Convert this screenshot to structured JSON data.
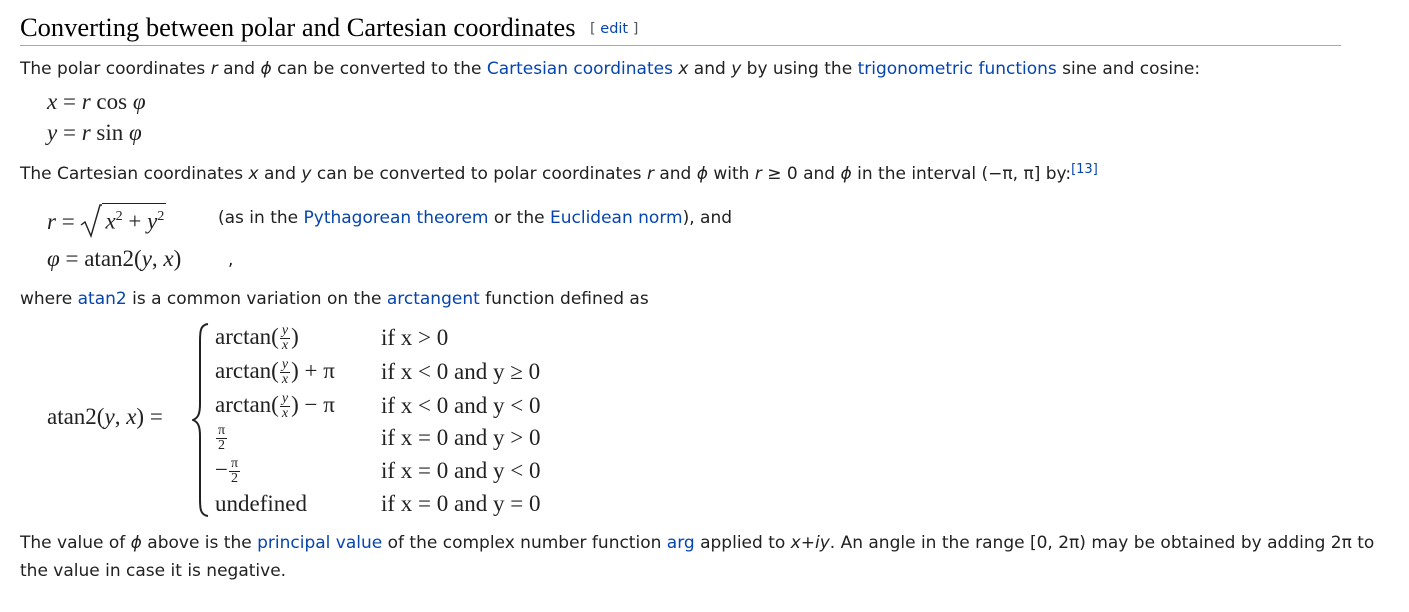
{
  "section": {
    "title": "Converting between polar and Cartesian coordinates",
    "edit_bracket_open": "[",
    "edit_label": "edit",
    "edit_bracket_close": "]"
  },
  "p1": {
    "t1": "The polar coordinates ",
    "r": "r",
    "t2": " and ",
    "phi": "ϕ",
    "t3": " can be converted to the ",
    "link_cartesian": "Cartesian coordinates",
    "t4": " ",
    "x": "x",
    "t5": " and ",
    "y": "y",
    "t6": " by using the ",
    "link_trig": "trigonometric functions",
    "t7": " sine and cosine:"
  },
  "eq_cartesian": {
    "x_lhs": "x",
    "x_eq": " = ",
    "x_r": "r",
    "x_fn": " cos ",
    "x_phi": "φ",
    "y_lhs": "y",
    "y_eq": " = ",
    "y_r": "r",
    "y_fn": " sin ",
    "y_phi": "φ"
  },
  "p2": {
    "t1": "The Cartesian coordinates ",
    "x": "x",
    "t2": " and ",
    "y": "y",
    "t3": " can be converted to polar coordinates ",
    "r": "r",
    "t4": " and ",
    "phi": "ϕ",
    "t5": " with ",
    "r2": "r",
    "t6": " ≥ 0 and ",
    "phi2": "ϕ",
    "t7": " in the interval (−π, π] by:",
    "ref": "[13]"
  },
  "eq_polar": {
    "r_lhs": "r",
    "r_eq": " = ",
    "x": "x",
    "sq1": "2",
    "plus": " + ",
    "y": "y",
    "sq2": "2",
    "phi_lhs": "φ",
    "phi_eq": " = ",
    "atan2": "atan2(",
    "args_y": "y",
    "args_sep": ", ",
    "args_x": "x",
    "atan2_close": ")",
    "comma": ","
  },
  "note": {
    "t1": "(as in the ",
    "link_pyth": "Pythagorean theorem",
    "t2": " or the ",
    "link_euclid": "Euclidean norm",
    "t3": "), and"
  },
  "p3": {
    "t1": "where ",
    "link_atan2": "atan2",
    "t2": " is a common variation on the ",
    "link_arctan": "arctangent",
    "t3": " function defined as"
  },
  "atan2_def": {
    "lhs_fn": "atan2(",
    "lhs_y": "y",
    "lhs_sep": ", ",
    "lhs_x": "x",
    "lhs_close": ") =",
    "cases": [
      {
        "value_fn": "arctan(",
        "frac_num": "y",
        "frac_den": "x",
        "value_close": ")",
        "value_tail": "",
        "cond": "if x > 0"
      },
      {
        "value_fn": "arctan(",
        "frac_num": "y",
        "frac_den": "x",
        "value_close": ")",
        "value_tail": " + π",
        "cond": "if x < 0 and y ≥ 0"
      },
      {
        "value_fn": "arctan(",
        "frac_num": "y",
        "frac_den": "x",
        "value_close": ")",
        "value_tail": " − π",
        "cond": "if x < 0 and y < 0"
      },
      {
        "value_prefix": "",
        "frac_num": "π",
        "frac_den": "2",
        "cond": "if x = 0 and y > 0"
      },
      {
        "value_prefix": "−",
        "frac_num": "π",
        "frac_den": "2",
        "cond": "if x = 0 and y < 0"
      },
      {
        "value_text": "undefined",
        "cond": "if x = 0 and y = 0"
      }
    ]
  },
  "p4": {
    "t1": "The value of ",
    "phi": "ϕ",
    "t2": " above is the ",
    "link_principal": "principal value",
    "t3": " of the complex number function ",
    "link_arg": "arg",
    "t4": " applied to ",
    "expr": "x+iy",
    "t5": ". An angle in the range [0, 2π) may be obtained by adding 2π to the value in case it is negative."
  },
  "colors": {
    "text": "#202122",
    "link": "#0645ad",
    "rule": "#a2a9b1"
  }
}
